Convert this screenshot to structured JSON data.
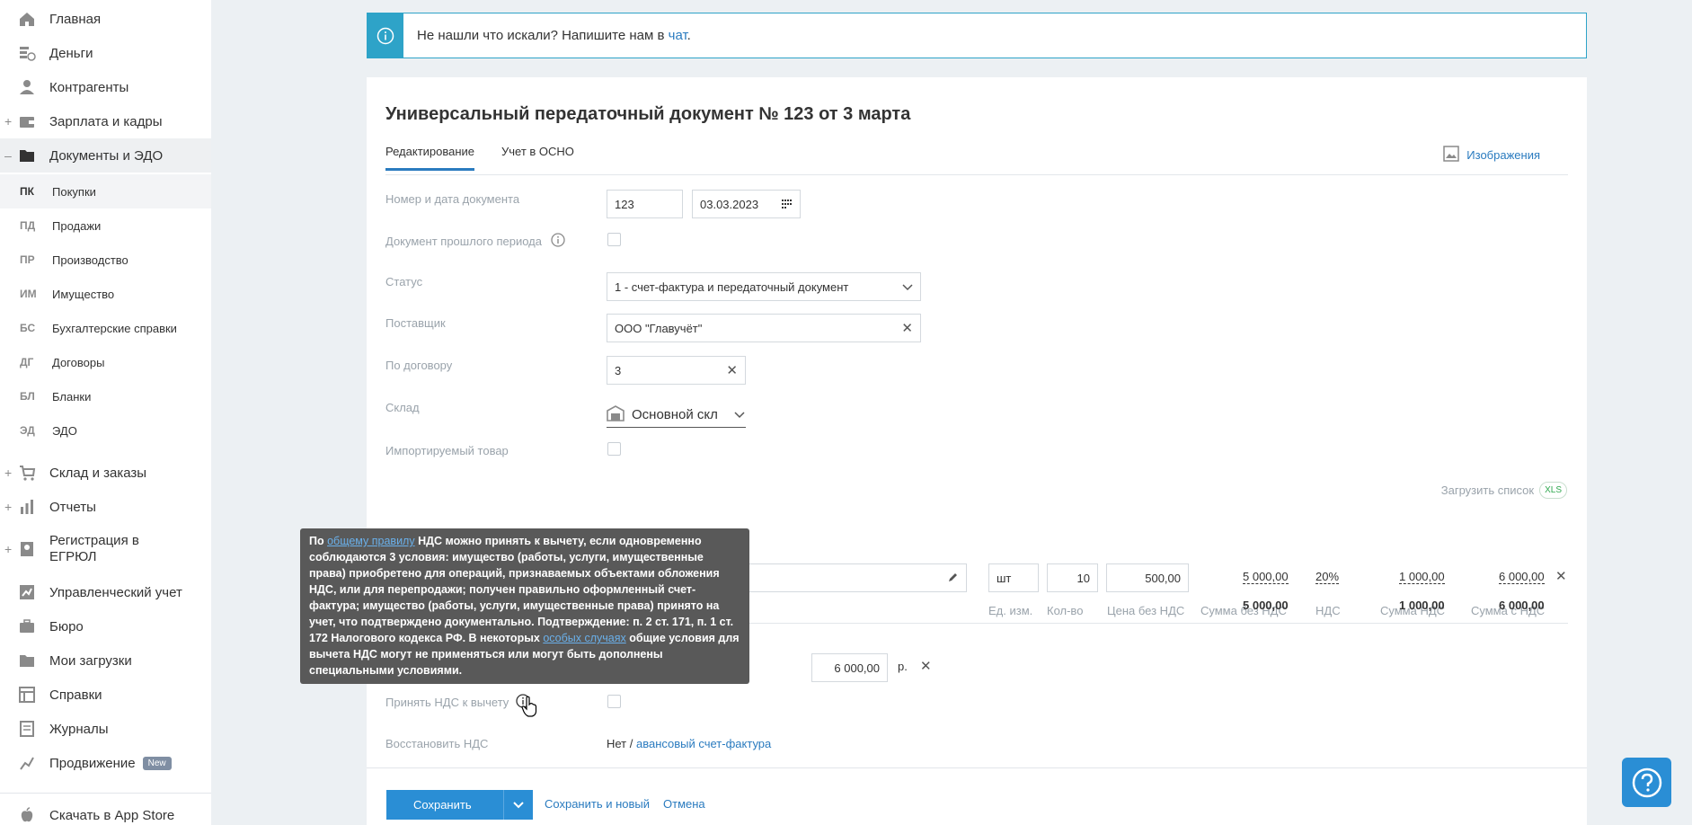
{
  "sidebar": {
    "items": [
      {
        "label": "Главная",
        "icon": "home-icon",
        "plus": ""
      },
      {
        "label": "Деньги",
        "icon": "money-icon",
        "plus": ""
      },
      {
        "label": "Контрагенты",
        "icon": "contacts-icon",
        "plus": ""
      },
      {
        "label": "Зарплата и кадры",
        "icon": "wallet-icon",
        "plus": "+"
      },
      {
        "label": "Документы и ЭДО",
        "icon": "folder-icon",
        "plus": "–"
      }
    ],
    "subitems": [
      {
        "abbr": "ПК",
        "label": "Покупки"
      },
      {
        "abbr": "ПД",
        "label": "Продажи"
      },
      {
        "abbr": "ПР",
        "label": "Производство"
      },
      {
        "abbr": "ИМ",
        "label": "Имущество"
      },
      {
        "abbr": "БС",
        "label": "Бухгалтерские справки"
      },
      {
        "abbr": "ДГ",
        "label": "Договоры"
      },
      {
        "abbr": "БЛ",
        "label": "Бланки"
      },
      {
        "abbr": "ЭД",
        "label": "ЭДО"
      }
    ],
    "items2": [
      {
        "label": "Склад и заказы",
        "plus": "+"
      },
      {
        "label": "Отчеты",
        "plus": "+"
      },
      {
        "label": "Регистрация в",
        "label2": "ЕГРЮЛ",
        "plus": "+"
      },
      {
        "label": "Управленческий учет",
        "plus": ""
      },
      {
        "label": "Бюро",
        "plus": ""
      },
      {
        "label": "Мои загрузки",
        "plus": ""
      },
      {
        "label": "Справки",
        "plus": ""
      },
      {
        "label": "Журналы",
        "plus": ""
      },
      {
        "label": "Продвижение",
        "plus": "",
        "badge": "New"
      },
      {
        "label": "Скачать в App Store",
        "plus": ""
      }
    ]
  },
  "banner": {
    "text": "Не нашли что искали? Напишите нам в ",
    "link": "чат",
    "end": "."
  },
  "document": {
    "title": "Универсальный передаточный документ № 123 от 3 марта",
    "tabs": [
      "Редактирование",
      "Учет в ОСНО"
    ],
    "images_link": "Изображения",
    "fields": {
      "number_label": "Номер и дата документа",
      "number_value": "123",
      "date_value": "03.03.2023",
      "prev_period_label": "Документ прошлого периода",
      "status_label": "Статус",
      "status_value": "1 - счет-фактура и передаточный документ",
      "supplier_label": "Поставщик",
      "supplier_value": "ООО \"Главучёт\"",
      "contract_label": "По договору",
      "contract_value": "3",
      "warehouse_label": "Склад",
      "warehouse_value": "Основной скл",
      "imported_label": "Импортируемый товар",
      "vat_deduct_label": "Принять НДС к вычету",
      "vat_restore_label": "Восстановить НДС",
      "vat_restore_value": "Нет / ",
      "vat_restore_link": "авансовый счет-фактура"
    },
    "upload": {
      "label": "Загрузить список",
      "badge": "XLS"
    },
    "table": {
      "headers": [
        "Ед. изм.",
        "Кол-во",
        "Цена без НДС",
        "Сумма без НДС",
        "НДС",
        "Сумма НДС",
        "Сумма с НДС"
      ],
      "row": {
        "unit": "шт",
        "qty": "10",
        "price": "500,00",
        "sum_no_vat": "5 000,00",
        "vat": "20%",
        "vat_sum": "1 000,00",
        "sum_with_vat": "6 000,00"
      },
      "totals": {
        "sum_no_vat": "5 000,00",
        "vat_sum": "1 000,00",
        "sum_with_vat": "6 000,00"
      }
    },
    "payment": {
      "value": "6 000,00",
      "currency": "р."
    }
  },
  "tooltip": {
    "p1": "По ",
    "link1": "общему правилу",
    "p2": " НДС можно принять к вычету, если одновременно соблюдаются 3 условия: имущество (работы, услуги, имущественные права) приобретено для операций, признаваемых объектами обложения НДС, или для перепродажи; получен правильно оформленный счет-фактура; имущество (работы, услуги, имущественные права) принято на учет, что подтверждено документально. Подтверждение: п. 2 ст. 171, п. 1 ст. 172 Налогового кодекса РФ. В некоторых ",
    "link2": "особых случаях",
    "p3": " общие условия для вычета НДС могут не применяться или могут быть дополнены специальными условиями."
  },
  "actions": {
    "save": "Сохранить",
    "save_new": "Сохранить и новый",
    "cancel": "Отмена"
  },
  "colors": {
    "accent": "#2a8ed5",
    "banner": "#2ea3c8",
    "tooltip_bg": "#595959"
  }
}
